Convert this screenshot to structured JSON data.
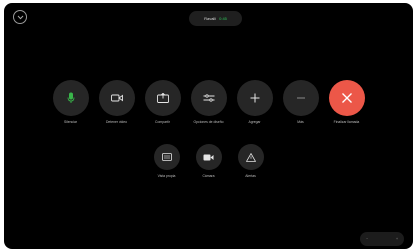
{
  "header": {
    "collapse_icon": "chevron-down-icon",
    "call_name": "Ravalli",
    "call_timer": "0:45"
  },
  "controls_primary": [
    {
      "id": "mute",
      "label": "Silenciar",
      "icon": "microphone-icon"
    },
    {
      "id": "video",
      "label": "Detener video",
      "icon": "camera-icon"
    },
    {
      "id": "share",
      "label": "Compartir",
      "icon": "share-icon"
    },
    {
      "id": "layout",
      "label": "Opciones de diseño",
      "icon": "layout-icon"
    },
    {
      "id": "add",
      "label": "Agregar",
      "icon": "plus-icon"
    },
    {
      "id": "more",
      "label": "Más",
      "icon": "more-icon"
    },
    {
      "id": "end",
      "label": "Finalizar llamada",
      "icon": "close-icon"
    }
  ],
  "controls_secondary": [
    {
      "id": "keypad",
      "label": "Vista propia",
      "icon": "keypad-icon"
    },
    {
      "id": "camera",
      "label": "Cámara",
      "icon": "video-icon"
    },
    {
      "id": "alert",
      "label": "Alertas",
      "icon": "warning-icon"
    }
  ],
  "zoom": {
    "minus": "−",
    "plus": "+"
  },
  "colors": {
    "background": "#000000",
    "button": "#262626",
    "end_call": "#ec5748",
    "mic_active": "#39b54a",
    "timer": "#2fc35a"
  }
}
